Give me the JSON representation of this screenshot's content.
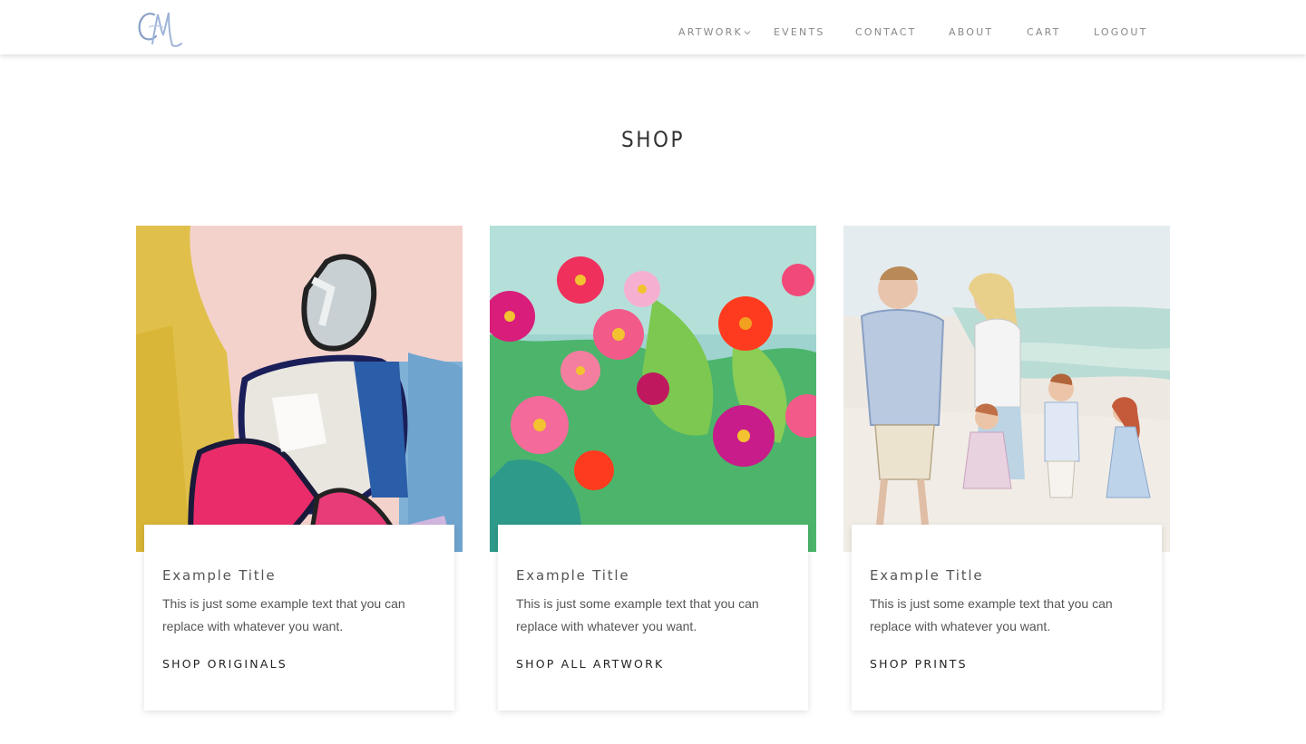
{
  "header": {
    "logo_text": "CM",
    "nav": [
      {
        "label": "ARTWORK",
        "has_dropdown": true
      },
      {
        "label": "EVENTS"
      },
      {
        "label": "CONTACT"
      },
      {
        "label": "ABOUT"
      },
      {
        "label": "CART"
      },
      {
        "label": "LOGOUT"
      }
    ]
  },
  "page": {
    "title": "SHOP"
  },
  "cards": [
    {
      "image": "abstract-figure-painting",
      "title": "Example Title",
      "text": "This is just some example text that you can replace with whatever you want.",
      "link": "SHOP ORIGINALS"
    },
    {
      "image": "zinnia-flowers-painting",
      "title": "Example Title",
      "text": "This is just some example text that you can replace with whatever you want.",
      "link": "SHOP ALL ARTWORK"
    },
    {
      "image": "family-beach-watercolor",
      "title": "Example Title",
      "text": "This is just some example text that you can replace with whatever you want.",
      "link": "SHOP PRINTS"
    }
  ],
  "colors": {
    "nav_text": "#888888",
    "heading": "#333333",
    "body_text": "#555555"
  }
}
